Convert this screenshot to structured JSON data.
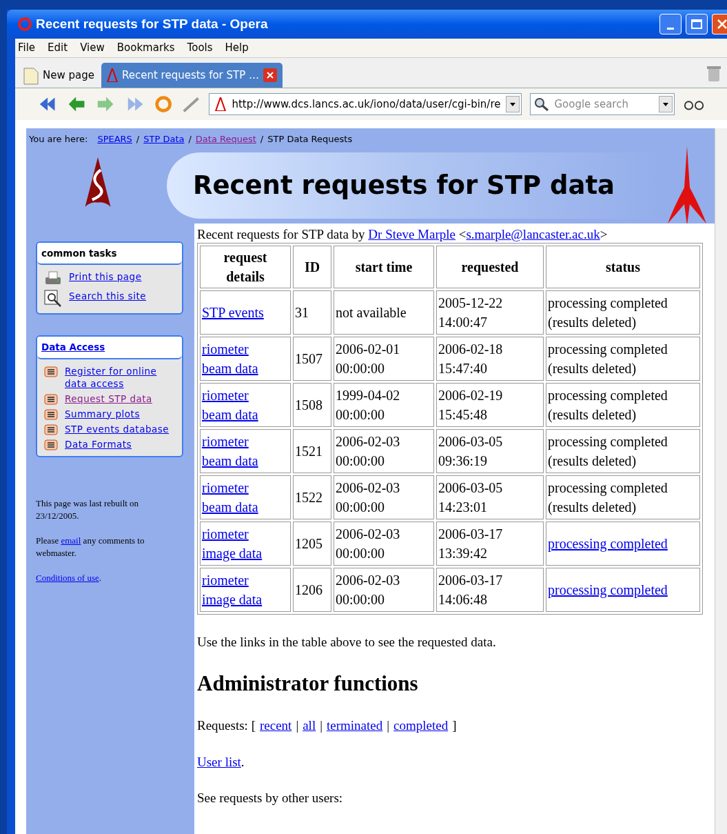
{
  "window": {
    "title": "Recent requests for STP data - Opera"
  },
  "menu": [
    "File",
    "Edit",
    "View",
    "Bookmarks",
    "Tools",
    "Help"
  ],
  "tabs": [
    {
      "label": "New page",
      "selected": false
    },
    {
      "label": "Recent requests for STP …",
      "selected": true
    }
  ],
  "address": {
    "value": "http://www.dcs.lancs.ac.uk/iono/data/user/cgi-bin/re"
  },
  "search": {
    "placeholder": "Google search"
  },
  "breadcrumb": {
    "label": "You are here:",
    "links": [
      {
        "text": "SPEARS",
        "visited": false
      },
      {
        "text": "STP Data",
        "visited": false
      },
      {
        "text": "Data Request",
        "visited": true
      }
    ],
    "separator": "/",
    "current": "STP Data Requests"
  },
  "page_title": "Recent requests for STP data",
  "sidebar": {
    "boxes": [
      {
        "title": "common tasks",
        "title_link": false,
        "items": [
          {
            "kind": "print",
            "text": "Print this page",
            "visited": false
          },
          {
            "kind": "search",
            "text": "Search this site",
            "visited": false
          }
        ]
      },
      {
        "title": "Data Access",
        "title_link": true,
        "items": [
          {
            "kind": "doc",
            "text": "Register for online data access",
            "visited": false
          },
          {
            "kind": "doc",
            "text": "Request STP data",
            "visited": true
          },
          {
            "kind": "doc",
            "text": "Summary plots",
            "visited": false
          },
          {
            "kind": "doc",
            "text": "STP events database",
            "visited": false
          },
          {
            "kind": "doc",
            "text": "Data Formats",
            "visited": false
          }
        ]
      }
    ],
    "rebuilt": "This page was last rebuilt on 23/12/2005.",
    "contact": {
      "before": "Please",
      "link": "email",
      "after": "any comments to webmaster."
    },
    "conditions": {
      "link": "Conditions of use",
      "after": "."
    }
  },
  "intro": {
    "text": "Recent requests for STP data by",
    "author": "Dr Steve Marple",
    "email_open": "<",
    "email": "s.marple@lancaster.ac.uk",
    "email_close": ">"
  },
  "table": {
    "columns": [
      "request details",
      "ID",
      "start time",
      "requested",
      "status"
    ],
    "rows": [
      {
        "details": "STP events",
        "id": "31",
        "start": "not available",
        "requested": "2005-12-22 14:00:47",
        "status": "processing completed (results deleted)",
        "status_link": false
      },
      {
        "details": "riometer beam data",
        "id": "1507",
        "start": "2006-02-01 00:00:00",
        "requested": "2006-02-18 15:47:40",
        "status": "processing completed (results deleted)",
        "status_link": false
      },
      {
        "details": "riometer beam data",
        "id": "1508",
        "start": "1999-04-02 00:00:00",
        "requested": "2006-02-19 15:45:48",
        "status": "processing completed (results deleted)",
        "status_link": false
      },
      {
        "details": "riometer beam data",
        "id": "1521",
        "start": "2006-02-03 00:00:00",
        "requested": "2006-03-05 09:36:19",
        "status": "processing completed (results deleted)",
        "status_link": false
      },
      {
        "details": "riometer beam data",
        "id": "1522",
        "start": "2006-02-03 00:00:00",
        "requested": "2006-03-05 14:23:01",
        "status": "processing completed (results deleted)",
        "status_link": false
      },
      {
        "details": "riometer image data",
        "id": "1205",
        "start": "2006-02-03 00:00:00",
        "requested": "2006-03-17 13:39:42",
        "status": "processing completed",
        "status_link": true
      },
      {
        "details": "riometer image data",
        "id": "1206",
        "start": "2006-02-03 00:00:00",
        "requested": "2006-03-17 14:06:48",
        "status": "processing completed",
        "status_link": true
      }
    ]
  },
  "note": "Use the links in the table above to see the requested data.",
  "admin": {
    "heading": "Administrator functions",
    "requests_label": "Requests: [",
    "links": [
      "recent",
      "all",
      "terminated",
      "completed"
    ],
    "separators": [
      "|",
      "|",
      "|"
    ],
    "requests_end": "]",
    "user_list": "User list",
    "user_list_after": ".",
    "others": "See requests by other users:"
  }
}
